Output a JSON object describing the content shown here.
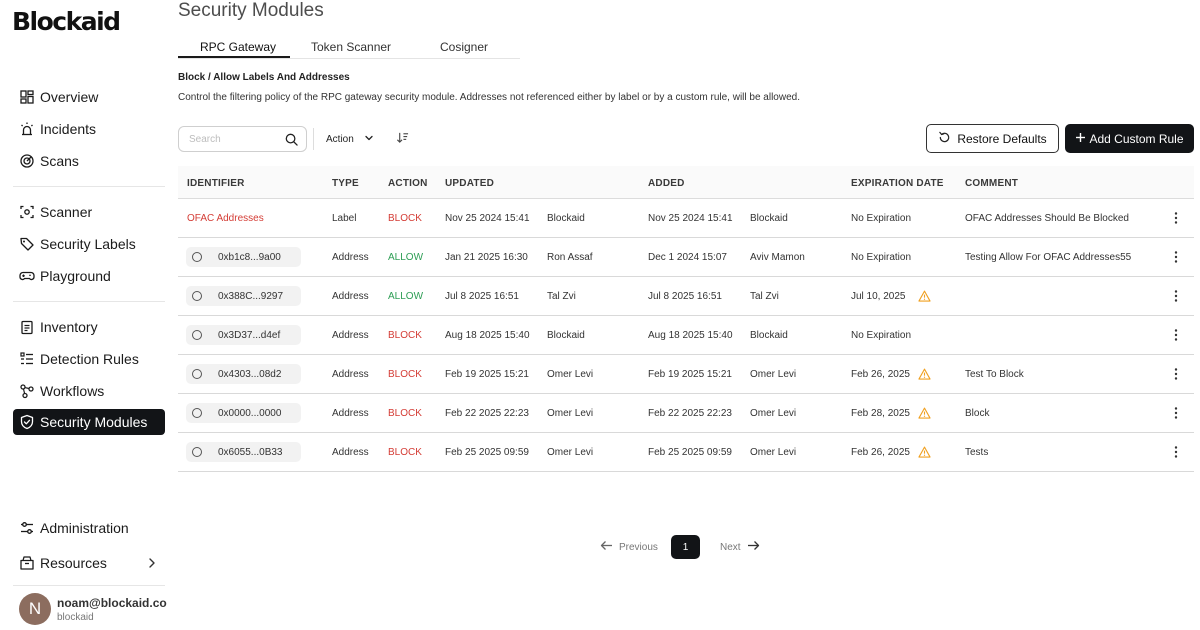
{
  "app": {
    "logo_text": "Blockaid",
    "page_title": "Security Modules"
  },
  "sidebar": {
    "groups": [
      [
        {
          "label": "Overview",
          "icon": "dashboard-icon"
        },
        {
          "label": "Incidents",
          "icon": "alarm-icon"
        },
        {
          "label": "Scans",
          "icon": "radar-icon"
        }
      ],
      [
        {
          "label": "Scanner",
          "icon": "scan-icon"
        },
        {
          "label": "Security Labels",
          "icon": "tag-icon"
        },
        {
          "label": "Playground",
          "icon": "gamepad-icon"
        }
      ],
      [
        {
          "label": "Inventory",
          "icon": "clipboard-icon"
        },
        {
          "label": "Detection Rules",
          "icon": "rules-icon"
        },
        {
          "label": "Workflows",
          "icon": "workflow-icon"
        },
        {
          "label": "Security Modules",
          "icon": "shield-check-icon",
          "active": true
        }
      ]
    ],
    "bottom": [
      {
        "label": "Administration",
        "icon": "sliders-icon"
      },
      {
        "label": "Resources",
        "icon": "package-icon"
      }
    ],
    "user": {
      "initial": "N",
      "email": "noam@blockaid.co",
      "org": "blockaid"
    }
  },
  "tabs": [
    {
      "label": "RPC Gateway",
      "active": true
    },
    {
      "label": "Token Scanner",
      "active": false
    },
    {
      "label": "Cosigner",
      "active": false
    }
  ],
  "section": {
    "title": "Block / Allow Labels And Addresses",
    "description": "Control the filtering policy of the RPC gateway security module. Addresses not referenced either by label or by a custom rule, will be allowed."
  },
  "toolbar": {
    "search_placeholder": "Search",
    "action_label": "Action",
    "restore_label": "Restore Defaults",
    "add_label": "Add Custom Rule"
  },
  "table": {
    "columns": [
      "IDENTIFIER",
      "TYPE",
      "ACTION",
      "UPDATED",
      "ADDED",
      "EXPIRATION DATE",
      "COMMENT"
    ],
    "rows": [
      {
        "identifier": "OFAC Addresses",
        "is_label": true,
        "type": "Label",
        "action": "BLOCK",
        "updated": "Nov 25 2024 15:41",
        "updated_by": "Blockaid",
        "added": "Nov 25 2024 15:41",
        "added_by": "Blockaid",
        "expiration": "No Expiration",
        "warning": false,
        "comment": "OFAC Addresses Should Be Blocked"
      },
      {
        "identifier": "0xb1c8...9a00",
        "is_label": false,
        "type": "Address",
        "action": "ALLOW",
        "updated": "Jan 21 2025 16:30",
        "updated_by": "Ron Assaf",
        "added": "Dec 1 2024 15:07",
        "added_by": "Aviv Mamon",
        "expiration": "No Expiration",
        "warning": false,
        "comment": "Testing Allow For OFAC Addresses55"
      },
      {
        "identifier": "0x388C...9297",
        "is_label": false,
        "type": "Address",
        "action": "ALLOW",
        "updated": "Jul 8 2025 16:51",
        "updated_by": "Tal Zvi",
        "added": "Jul 8 2025 16:51",
        "added_by": "Tal Zvi",
        "expiration": "Jul 10, 2025",
        "warning": true,
        "comment": ""
      },
      {
        "identifier": "0x3D37...d4ef",
        "is_label": false,
        "type": "Address",
        "action": "BLOCK",
        "updated": "Aug 18 2025 15:40",
        "updated_by": "Blockaid",
        "added": "Aug 18 2025 15:40",
        "added_by": "Blockaid",
        "expiration": "No Expiration",
        "warning": false,
        "comment": ""
      },
      {
        "identifier": "0x4303...08d2",
        "is_label": false,
        "type": "Address",
        "action": "BLOCK",
        "updated": "Feb 19 2025 15:21",
        "updated_by": "Omer Levi",
        "added": "Feb 19 2025 15:21",
        "added_by": "Omer Levi",
        "expiration": "Feb 26, 2025",
        "warning": true,
        "comment": "Test To Block"
      },
      {
        "identifier": "0x0000...0000",
        "is_label": false,
        "type": "Address",
        "action": "BLOCK",
        "updated": "Feb 22 2025 22:23",
        "updated_by": "Omer Levi",
        "added": "Feb 22 2025 22:23",
        "added_by": "Omer Levi",
        "expiration": "Feb 28, 2025",
        "warning": true,
        "comment": "Block"
      },
      {
        "identifier": "0x6055...0B33",
        "is_label": false,
        "type": "Address",
        "action": "BLOCK",
        "updated": "Feb 25 2025 09:59",
        "updated_by": "Omer Levi",
        "added": "Feb 25 2025 09:59",
        "added_by": "Omer Levi",
        "expiration": "Feb 26, 2025",
        "warning": true,
        "comment": "Tests"
      }
    ]
  },
  "pagination": {
    "previous_label": "Previous",
    "current_page": "1",
    "next_label": "Next"
  },
  "colors": {
    "block": "#d43c35",
    "allow": "#2e9e55",
    "warning": "#f0a020",
    "dark": "#121417"
  }
}
